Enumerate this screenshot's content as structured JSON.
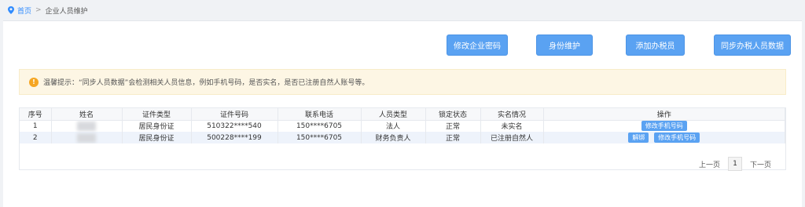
{
  "breadcrumb": {
    "home": "首页",
    "separator": ">",
    "current": "企业人员维护"
  },
  "toolbar": {
    "modify_password": "修改企业密码",
    "identity_maintain": "身份维护",
    "add_taxpayer": "添加办税员",
    "sync_taxpayer": "同步办税人员数据"
  },
  "tip": {
    "text": "温馨提示：“同步人员数据”会检测相关人员信息，例如手机号码，是否实名，是否已注册自然人账号等。"
  },
  "table": {
    "headers": [
      "序号",
      "姓名",
      "证件类型",
      "证件号码",
      "联系电话",
      "人员类型",
      "锁定状态",
      "实名情况",
      "操作"
    ],
    "rows": [
      {
        "no": "1",
        "name": "",
        "id_type": "居民身份证",
        "id_number": "510322****540",
        "phone": "150****6705",
        "person_type": "法人",
        "lock": "正常",
        "real_name": "未实名",
        "actions": [
          "修改手机号码"
        ]
      },
      {
        "no": "2",
        "name": "",
        "id_type": "居民身份证",
        "id_number": "500228****199",
        "phone": "150****6705",
        "person_type": "财务负责人",
        "lock": "正常",
        "real_name": "已注册自然人",
        "actions": [
          "解绑",
          "修改手机号码"
        ]
      }
    ]
  },
  "pager": {
    "prev": "上一页",
    "current": "1",
    "next": "下一页"
  },
  "colors": {
    "primary": "#5aa2f2",
    "link": "#2f8bff",
    "tip_bg": "#fdf6e4",
    "warn": "#f5a623"
  },
  "icons": {
    "breadcrumb": "location-pin-icon",
    "tip": "warning-icon"
  }
}
